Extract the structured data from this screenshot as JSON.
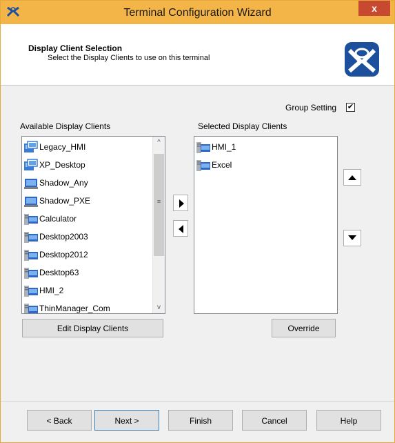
{
  "window": {
    "title": "Terminal Configuration Wizard",
    "close_label": "x"
  },
  "header": {
    "title": "Display Client Selection",
    "subtitle": "Select the Display Clients to use on this terminal"
  },
  "group_setting": {
    "label": "Group Setting",
    "checked": true
  },
  "available": {
    "label": "Available Display Clients",
    "items": [
      {
        "label": "Legacy_HMI",
        "icon": "remote-app-icon"
      },
      {
        "label": "XP_Desktop",
        "icon": "remote-app-icon"
      },
      {
        "label": "Shadow_Any",
        "icon": "monitor-icon"
      },
      {
        "label": "Shadow_PXE",
        "icon": "monitor-icon"
      },
      {
        "label": "Calculator",
        "icon": "server-app-icon"
      },
      {
        "label": "Desktop2003",
        "icon": "server-app-icon"
      },
      {
        "label": "Desktop2012",
        "icon": "server-app-icon"
      },
      {
        "label": "Desktop63",
        "icon": "server-app-icon"
      },
      {
        "label": "HMI_2",
        "icon": "server-app-icon"
      },
      {
        "label": "ThinManager_Com",
        "icon": "server-app-icon"
      }
    ],
    "edit_button": "Edit Display Clients"
  },
  "selected": {
    "label": "Selected Display Clients",
    "items": [
      {
        "label": "HMI_1",
        "icon": "server-app-icon"
      },
      {
        "label": "Excel",
        "icon": "server-app-icon"
      }
    ],
    "override_button": "Override"
  },
  "transfer": {
    "add_icon": "arrow-right-icon",
    "remove_icon": "arrow-left-icon"
  },
  "order": {
    "up_icon": "arrow-up-icon",
    "down_icon": "arrow-down-icon"
  },
  "footer": {
    "back": "< Back",
    "next": "Next >",
    "finish": "Finish",
    "cancel": "Cancel",
    "help": "Help"
  },
  "colors": {
    "titlebar": "#f4b548",
    "close": "#c7492f",
    "logo": "#1c4f9c"
  }
}
